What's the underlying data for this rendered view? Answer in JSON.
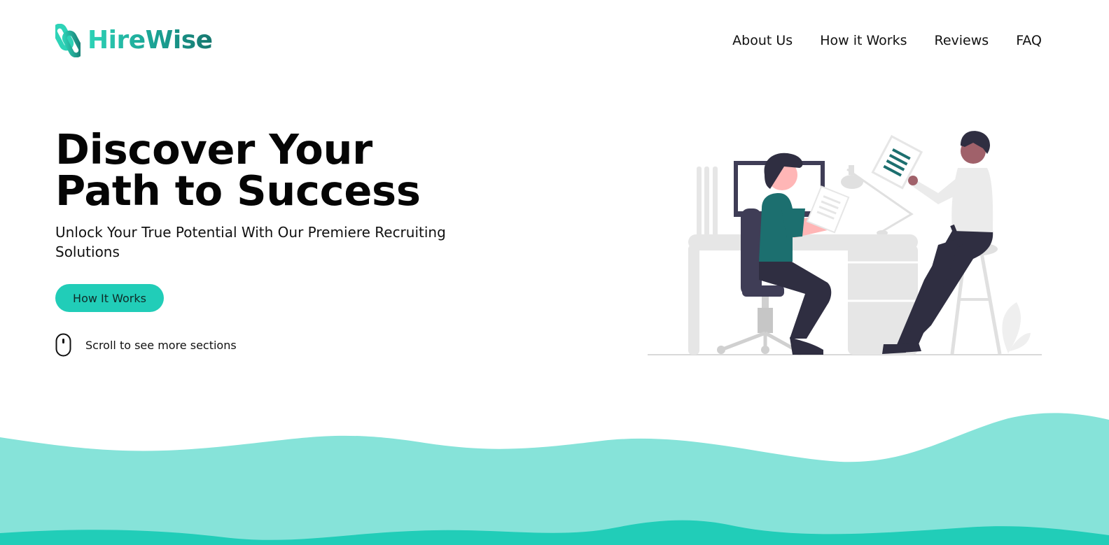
{
  "brand": {
    "name": "HireWise",
    "colors": {
      "accent": "#21cdb8",
      "wave_light": "#86e3d9",
      "wave_dark": "#21cdb8",
      "logo_dark": "#17776f"
    }
  },
  "nav": {
    "items": [
      {
        "label": "About Us"
      },
      {
        "label": "How it Works"
      },
      {
        "label": "Reviews"
      },
      {
        "label": "FAQ"
      }
    ]
  },
  "hero": {
    "title": "Discover Your Path to Success",
    "subtitle": "Unlock Your True Potential With Our Premiere Recruiting Solutions",
    "cta_label": "How It Works",
    "scroll_hint": "Scroll to see more sections"
  },
  "icons": {
    "logo": "paperclip-logo-icon",
    "scroll": "mouse-icon"
  }
}
